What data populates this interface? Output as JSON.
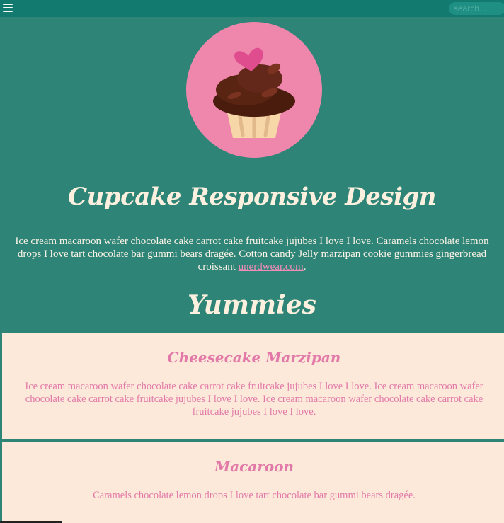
{
  "header": {
    "menu_icon": "hamburger-menu-icon",
    "search_placeholder": "search..."
  },
  "logo": {
    "icon": "cupcake-logo"
  },
  "page": {
    "title": "Cupcake Responsive Design",
    "intro_text": "Ice cream macaroon wafer chocolate cake carrot cake fruitcake jujubes I love I love. Caramels chocolate lemon drops I love tart chocolate bar gummi bears dragée. Cotton candy Jelly marzipan cookie gummies gingerbread croissant ",
    "intro_link": "unerdwear.com",
    "intro_end": ".",
    "section_title": "Yummies"
  },
  "cards": [
    {
      "title": "Cheesecake Marzipan",
      "text": "Ice cream macaroon wafer chocolate cake carrot cake fruitcake jujubes I love I love. Ice cream macaroon wafer chocolate cake carrot cake fruitcake jujubes I love I love. Ice cream macaroon wafer chocolate cake carrot cake fruitcake jujubes I love I love."
    },
    {
      "title": "Macaroon",
      "text": "Caramels chocolate lemon drops I love tart chocolate bar gummi bears dragée."
    }
  ],
  "colors": {
    "background": "#2e8577",
    "topbar": "#137a70",
    "card_bg": "#fde9d9",
    "accent_pink": "#e27aa9"
  }
}
